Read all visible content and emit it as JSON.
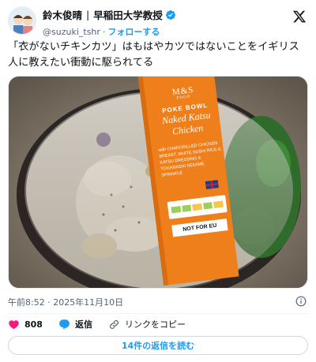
{
  "author": {
    "name": "鈴木俊晴",
    "affiliation": "早稲田大学教授",
    "handle": "@suzuki_tshr",
    "follow_label": "フォローする"
  },
  "tweet": {
    "text": "「衣がないチキンカツ」はもはやカツではないことをイギリス人に教えたい衝動に駆られてる"
  },
  "media": {
    "package_brand": "M&S",
    "package_brand_sub": "FOOD",
    "package_title_1": "POKE BOWL",
    "package_title_2": "Naked Katsu",
    "package_title_3": "Chicken",
    "package_desc": "with CHARGRILLED CHICKEN BREAST, WHITE SUSHI RICE & KATSU DRESSING & TOGARASHI SESAME SPRINKLE",
    "not_for_eu": "NOT FOR EU",
    "colors": {
      "sleeve": "#ef7f1a",
      "greens": "#2f6b2a"
    }
  },
  "meta": {
    "timestamp": "午前8:52 · 2025年11月10日"
  },
  "actions": {
    "like_count": "808",
    "reply_label": "返信",
    "copy_link_label": "リンクをコピー"
  },
  "read_replies_label": "14件の返信を読む",
  "icons": [
    "x-logo-icon",
    "verified-badge-icon",
    "info-icon",
    "heart-icon",
    "reply-icon",
    "link-icon"
  ]
}
